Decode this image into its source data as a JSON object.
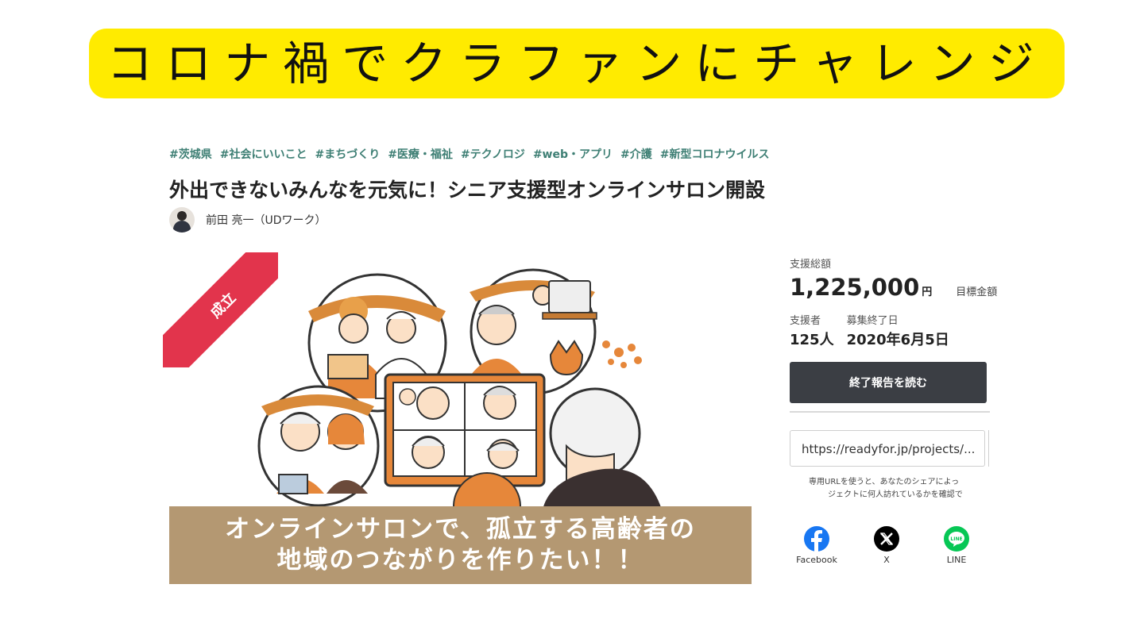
{
  "banner": {
    "text": "コロナ禍でクラファンにチャレンジ"
  },
  "tags": [
    "#茨城県",
    "#社会にいいこと",
    "#まちづくり",
    "#医療・福祉",
    "#テクノロジ",
    "#web・アプリ",
    "#介護",
    "#新型コロナウイルス"
  ],
  "project": {
    "title": "外出できないみんなを元気に！シニア支援型オンラインサロン開設",
    "author": "前田 亮一（UDワーク）"
  },
  "hero": {
    "ribbon": "成立",
    "caption_line1": "オンラインサロンで、孤立する高齢者の",
    "caption_line2": "地域のつながりを作りたい！！"
  },
  "sidebar": {
    "total_label": "支援総額",
    "total_amount": "1,225,000",
    "yen": "円",
    "goal_label": "目標金額",
    "supporters_label": "支援者",
    "supporters_value": "125人",
    "end_label": "募集終了日",
    "end_value": "2020年6月5日",
    "report_button": "終了報告を読む",
    "url_value": "https://readyfor.jp/projects/...",
    "note_line1": "専用URLを使うと、あなたのシェアによっ",
    "note_line2": "ジェクトに何人訪れているかを確認で"
  },
  "share": {
    "facebook": "Facebook",
    "x": "X",
    "line": "LINE"
  },
  "colors": {
    "banner": "#ffeb00",
    "tag": "#3e7f74",
    "ribbon": "#e2344c",
    "caption": "#b49872",
    "button": "#3b3e44",
    "facebook": "#1877f2",
    "x": "#000000",
    "line": "#06c755"
  }
}
